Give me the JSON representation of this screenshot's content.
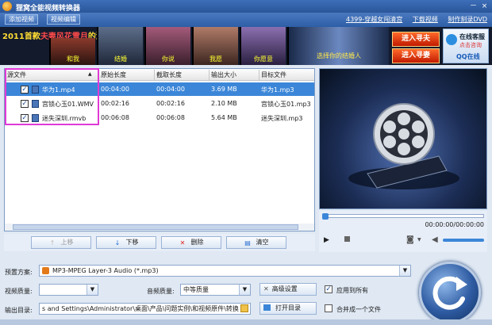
{
  "window": {
    "title": "狸窝全能视频转换器",
    "minimize": "－",
    "close": "×"
  },
  "menu": {
    "add_video": "添加视频",
    "edit_video": "视频编辑"
  },
  "top_links": [
    "4399-穿越女闯清宫",
    "下载视频",
    "制作刻录DVD"
  ],
  "banner": {
    "headline_pre": "2011首款",
    "headline_hl": "夫妻",
    "headline_mid": "风花雪月",
    "headline_post": "的游戏",
    "thumbs": [
      "和我",
      "结婚",
      "你说",
      "我愿",
      "你愿意"
    ],
    "promo": "选择你的结婚人",
    "enter_1": "进入寻夫",
    "enter_2": "进入寻妻",
    "service_title": "在线客服",
    "service_sub": "点击咨询",
    "qq": "QQ在线"
  },
  "table": {
    "columns": [
      "源文件",
      "原始长度",
      "截取长度",
      "输出大小",
      "目标文件"
    ],
    "rows": [
      {
        "name": "华为1.mp4",
        "orig": "00:04:00",
        "cut": "00:04:00",
        "size": "3.69 MB",
        "target": "华为1.mp3",
        "checked": true,
        "selected": true
      },
      {
        "name": "宫锁心玉01.WMV",
        "orig": "00:02:16",
        "cut": "00:02:16",
        "size": "2.10 MB",
        "target": "宫锁心玉01.mp3",
        "checked": true,
        "selected": false
      },
      {
        "name": "迷失深圳.rmvb",
        "orig": "00:06:08",
        "cut": "00:06:08",
        "size": "5.64 MB",
        "target": "迷失深圳.mp3",
        "checked": true,
        "selected": false
      }
    ]
  },
  "actions": {
    "up": "上移",
    "down": "下移",
    "delete": "删除",
    "clear": "清空"
  },
  "player": {
    "time": "00:00:00/00:00:00",
    "progress": 0
  },
  "settings": {
    "preset_label": "预置方案:",
    "preset_value": "MP3-MPEG Layer-3 Audio (*.mp3)",
    "video_quality_label": "视频质量:",
    "video_quality_value": "",
    "audio_quality_label": "音频质量:",
    "audio_quality_value": "中等质量",
    "advanced": "高级设置",
    "apply_all": "应用到所有",
    "apply_all_checked": true,
    "output_label": "输出目录:",
    "output_path": "s and Settings\\Administrator\\桌面\\产品\\问题实例\\和视频原件\\转换",
    "open_dir": "打开目录",
    "merge": "合并成一个文件",
    "merge_checked": false
  }
}
